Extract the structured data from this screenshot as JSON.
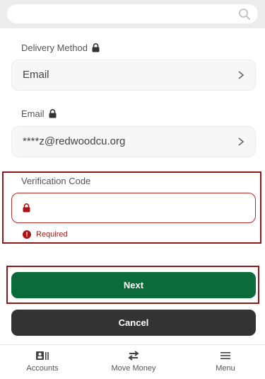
{
  "search": {
    "placeholder": ""
  },
  "delivery_method": {
    "label": "Delivery Method",
    "value": "Email"
  },
  "email": {
    "label": "Email",
    "value": "****z@redwoodcu.org"
  },
  "verification_code": {
    "label": "Verification Code",
    "value": "",
    "error": "Required"
  },
  "actions": {
    "next_label": "Next",
    "cancel_label": "Cancel"
  },
  "bottom_nav": {
    "items": [
      {
        "label": "Accounts",
        "icon": "accounts-icon"
      },
      {
        "label": "Move Money",
        "icon": "transfer-arrows-icon"
      },
      {
        "label": "Menu",
        "icon": "hamburger-menu-icon"
      }
    ]
  },
  "colors": {
    "primary_green": "#0b6b3a",
    "dark_button": "#333333",
    "error_red": "#a4161a",
    "highlight_border": "#8b1a1a"
  }
}
